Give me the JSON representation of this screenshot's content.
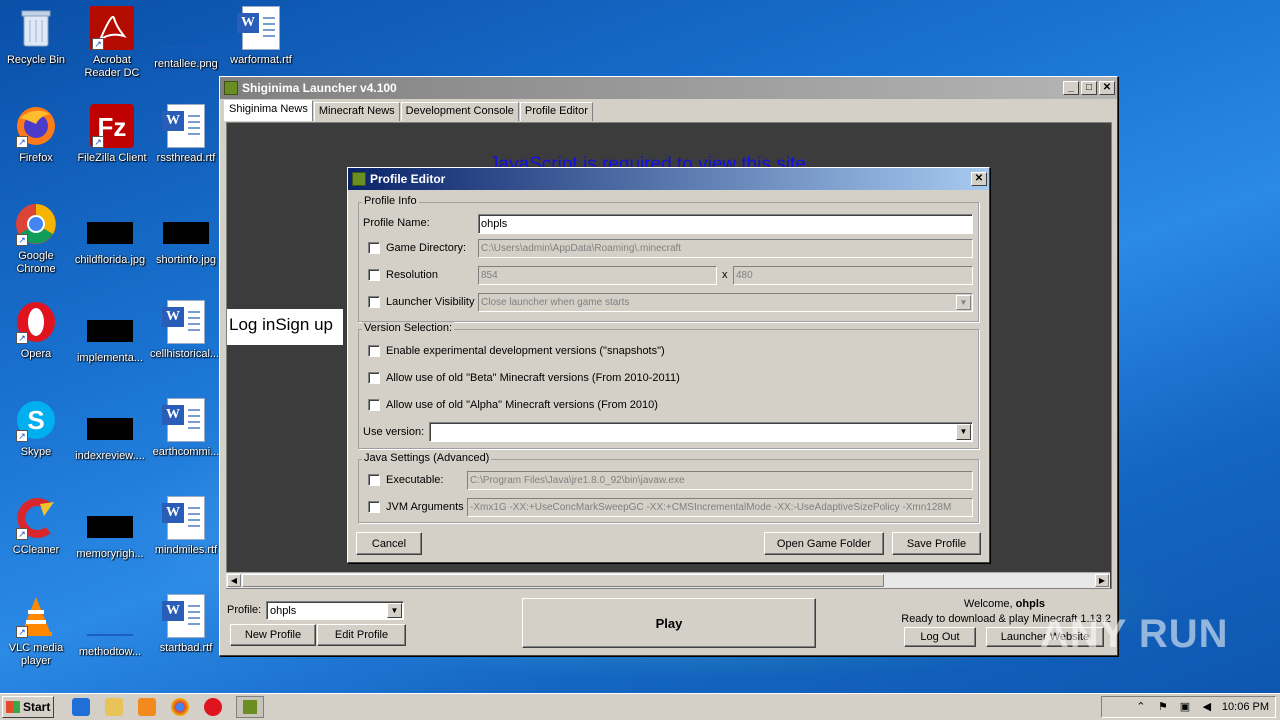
{
  "desktop": {
    "icons": [
      {
        "label": "Recycle Bin"
      },
      {
        "label": "Acrobat Reader DC"
      },
      {
        "label": "rentallee.png"
      },
      {
        "label": "warformat.rtf"
      },
      {
        "label": "Firefox"
      },
      {
        "label": "FileZilla Client"
      },
      {
        "label": "rssthread.rtf"
      },
      {
        "label": "Google Chrome"
      },
      {
        "label": "childflorida.jpg"
      },
      {
        "label": "shortinfo.jpg"
      },
      {
        "label": "Opera"
      },
      {
        "label": "implementa..."
      },
      {
        "label": "cellhistorical...."
      },
      {
        "label": "Skype"
      },
      {
        "label": "indexreview...."
      },
      {
        "label": "earthcommi..."
      },
      {
        "label": "CCleaner"
      },
      {
        "label": "memoryrigh..."
      },
      {
        "label": "mindmiles.rtf"
      },
      {
        "label": "VLC media player"
      },
      {
        "label": "methodtow..."
      },
      {
        "label": "startbad.rtf"
      }
    ]
  },
  "launcher": {
    "title": "Shiginima Launcher v4.100",
    "tabs": [
      "Shiginima News",
      "Minecraft News",
      "Development Console",
      "Profile Editor"
    ],
    "content": {
      "js_message": "JavaScript is required to view this site.",
      "login_text": "Log inSign up"
    },
    "profile_label": "Profile:",
    "profile_value": "ohpls",
    "new_profile": "New Profile",
    "edit_profile": "Edit Profile",
    "play": "Play",
    "welcome_prefix": "Welcome,",
    "welcome_user": "ohpls",
    "status": "Ready to download & play Minecraft 1.13.2",
    "log_out": "Log Out",
    "launcher_website": "Launcher Website"
  },
  "dialog": {
    "title": "Profile Editor",
    "profile_info": {
      "legend": "Profile Info",
      "name_label": "Profile Name:",
      "name_value": "ohpls",
      "game_dir_label": "Game Directory:",
      "game_dir_value": "C:\\Users\\admin\\AppData\\Roaming\\.minecraft",
      "resolution_label": "Resolution",
      "res_width": "854",
      "res_x": "x",
      "res_height": "480",
      "visibility_label": "Launcher Visibility",
      "visibility_value": "Close launcher when game starts"
    },
    "version": {
      "legend": "Version Selection:",
      "snapshots": "Enable experimental development versions (\"snapshots\")",
      "beta": "Allow use of old \"Beta\" Minecraft versions (From 2010-2011)",
      "alpha": "Allow use of old \"Alpha\" Minecraft versions (From 2010)",
      "use_version_label": "Use version:",
      "use_version_value": ""
    },
    "java": {
      "legend": "Java Settings (Advanced)",
      "exe_label": "Executable:",
      "exe_value": "C:\\Program Files\\Java\\jre1.8.0_92\\bin\\javaw.exe",
      "jvm_label": "JVM Arguments",
      "jvm_value": "-Xmx1G -XX:+UseConcMarkSweepGC -XX:+CMSIncrementalMode -XX:-UseAdaptiveSizePolicy -Xmn128M"
    },
    "cancel": "Cancel",
    "open_folder": "Open Game Folder",
    "save_profile": "Save Profile"
  },
  "taskbar": {
    "start": "Start",
    "clock": "10:06 PM"
  },
  "watermark": "ANY RUN"
}
